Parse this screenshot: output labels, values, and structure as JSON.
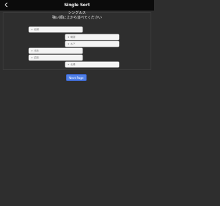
{
  "header": {
    "title": "Single Sort"
  },
  "panel": {
    "heading_line1": "シングルス",
    "heading_line2": "強い順に上から並べてください"
  },
  "tiles": [
    {
      "label": "北條"
    },
    {
      "label": "朝霧"
    },
    {
      "label": "水下"
    },
    {
      "label": "出出"
    },
    {
      "label": "岩田"
    },
    {
      "label": "北條"
    }
  ],
  "actions": {
    "next_label": "Next Page"
  }
}
